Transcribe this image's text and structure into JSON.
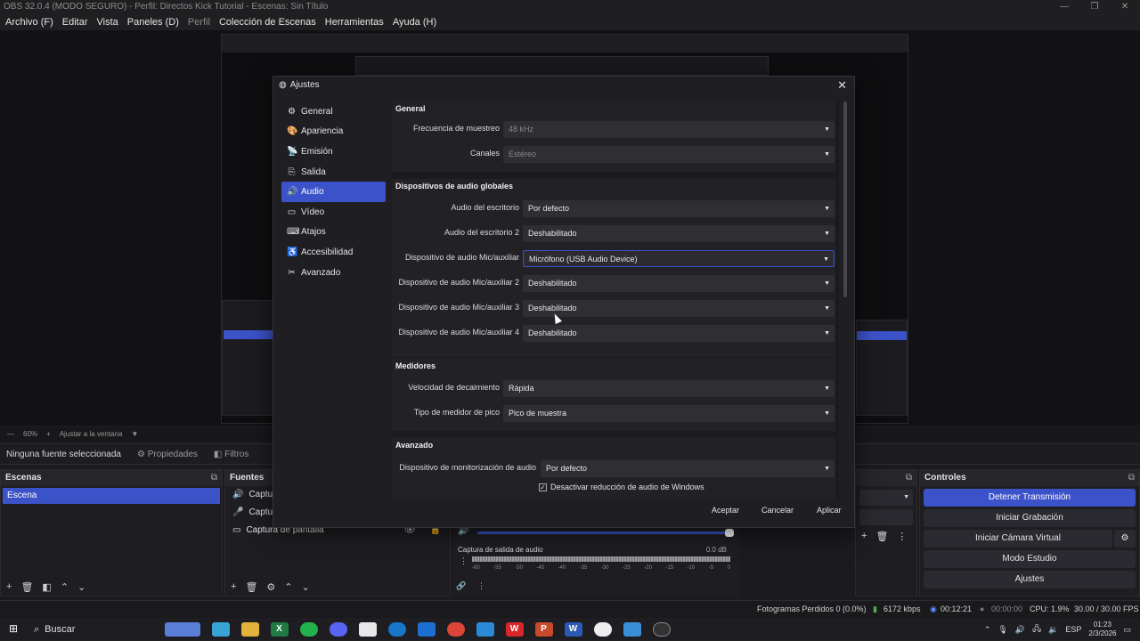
{
  "window": {
    "title": "OBS 32.0.4 (MODO SEGURO) - Perfil: Directos Kick Tutorial - Escenas: Sin Título"
  },
  "menu": [
    "Archivo (F)",
    "Editar",
    "Vista",
    "Paneles (D)",
    "Perfil",
    "Colección de Escenas",
    "Herramientas",
    "Ayuda (H)"
  ],
  "zoom": {
    "level": "60%",
    "fit": "Ajustar a la ventana"
  },
  "source_bar": {
    "none_selected": "Ninguna fuente seleccionada",
    "properties": "Propiedades",
    "filters": "Filtros"
  },
  "scenes": {
    "title": "Escenas",
    "items": [
      "Escena"
    ]
  },
  "sources": {
    "title": "Fuentes",
    "items": [
      "Captura",
      "Captura",
      "Captura de pantalla"
    ]
  },
  "mixer": {
    "label": "Captura de salida de audio",
    "db": "0.0 dB",
    "ticks": [
      "-60",
      "-55",
      "-50",
      "-45",
      "-40",
      "-35",
      "-30",
      "-25",
      "-20",
      "-15",
      "-10",
      "-5",
      "0"
    ]
  },
  "controls": {
    "title": "Controles",
    "buttons": [
      "Detener Transmisión",
      "Iniciar Grabación",
      "Iniciar Cámara Virtual",
      "Modo Estudio",
      "Ajustes"
    ]
  },
  "status": {
    "dropped": "Fotogramas Perdidos 0 (0.0%)",
    "bitrate": "6172 kbps",
    "stream_time": "00:12:21",
    "rec_time": "00:00:00",
    "cpu": "CPU: 1.9%",
    "fps": "30.00 / 30.00 FPS"
  },
  "taskbar": {
    "search": "Buscar",
    "lang": "ESP",
    "time": "01:23",
    "date": "2/3/2026"
  },
  "dialog": {
    "title": "Ajustes",
    "nav": [
      {
        "label": "General",
        "icon": "gear-icon"
      },
      {
        "label": "Apariencia",
        "icon": "palette-icon"
      },
      {
        "label": "Emisión",
        "icon": "antenna-icon"
      },
      {
        "label": "Salida",
        "icon": "output-icon"
      },
      {
        "label": "Audio",
        "icon": "speaker-icon"
      },
      {
        "label": "Vídeo",
        "icon": "monitor-icon"
      },
      {
        "label": "Atajos",
        "icon": "keyboard-icon"
      },
      {
        "label": "Accesibilidad",
        "icon": "accessibility-icon"
      },
      {
        "label": "Avanzado",
        "icon": "tools-icon"
      }
    ],
    "active_nav": "Audio",
    "general": {
      "title": "General",
      "sample_rate_label": "Frecuencia de muestreo",
      "sample_rate": "48 kHz",
      "channels_label": "Canales",
      "channels": "Estéreo"
    },
    "global_devices": {
      "title": "Dispositivos de audio globales",
      "rows": [
        {
          "label": "Audio del escritorio",
          "value": "Por defecto"
        },
        {
          "label": "Audio del escritorio 2",
          "value": "Deshabilitado"
        },
        {
          "label": "Dispositivo de audio Mic/auxiliar",
          "value": "Micrófono (USB Audio Device)"
        },
        {
          "label": "Dispositivo de audio Mic/auxiliar 2",
          "value": "Deshabilitado"
        },
        {
          "label": "Dispositivo de audio Mic/auxiliar 3",
          "value": "Deshabilitado"
        },
        {
          "label": "Dispositivo de audio Mic/auxiliar 4",
          "value": "Deshabilitado"
        }
      ]
    },
    "meters": {
      "title": "Medidores",
      "decay_label": "Velocidad de decaimiento",
      "decay": "Rápida",
      "peak_label": "Tipo de medidor de pico",
      "peak": "Pico de muestra"
    },
    "advanced": {
      "title": "Avanzado",
      "monitor_label": "Dispositivo de monitorización de audio",
      "monitor": "Por defecto",
      "ducking_label": "Desactivar reducción de audio de Windows"
    },
    "buttons": {
      "accept": "Aceptar",
      "cancel": "Cancelar",
      "apply": "Aplicar"
    }
  }
}
